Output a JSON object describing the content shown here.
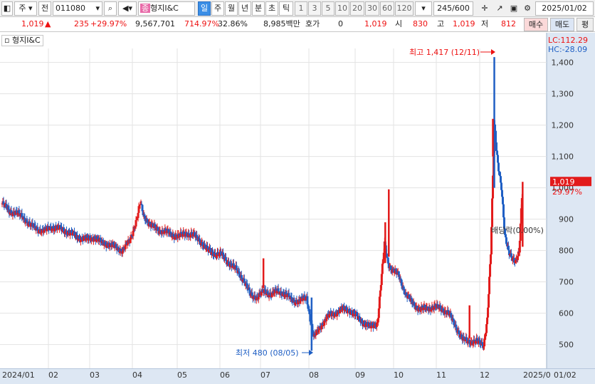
{
  "toolbar": {
    "market": "주",
    "prev": "전",
    "code": "011080",
    "stock_name": "형지I&C",
    "name_badge": "종",
    "periods": [
      "일",
      "주",
      "월",
      "년",
      "분",
      "초",
      "틱"
    ],
    "active_period": "일",
    "intervals": [
      "1",
      "3",
      "5",
      "10",
      "20",
      "30",
      "60",
      "120"
    ],
    "count": "245/600",
    "date": "2025/01/02"
  },
  "info": {
    "price": "1,019",
    "change": "235",
    "change_pct": "+29.97%",
    "volume": "9,567,701",
    "vol_ratio": "714.97%",
    "turnover": "32.86%",
    "amount": "8,985백만",
    "hoga_label": "호가",
    "hoga_value": "0",
    "hoga_price": "1,019",
    "open_label": "시",
    "open": "830",
    "high_label": "고",
    "high": "1,019",
    "low_label": "저",
    "low": "812",
    "buy_btn": "매수",
    "sell_btn": "매도",
    "eval_btn": "평"
  },
  "legend": {
    "name": "형지I&C"
  },
  "chart_data": {
    "type": "candlestick",
    "title": "형지I&C",
    "ylim": [
      440,
      1440
    ],
    "yticks": [
      "1,400",
      "1,300",
      "1,200",
      "1,100",
      "1,000",
      "900",
      "800",
      "700",
      "600",
      "500"
    ],
    "xticks": [
      "2024/01",
      "02",
      "03",
      "04",
      "05",
      "06",
      "07",
      "08",
      "09",
      "10",
      "11",
      "12",
      "2025/0",
      "01/02"
    ],
    "lc": "LC:112.29",
    "hc": "HC:-28.09",
    "last_price_label": "1,019",
    "last_change_label": "29.97%",
    "max_annotation": "최고 1,417 (12/11)",
    "min_annotation": "최저 480 (08/05)",
    "div_annotation": "배당락(0.00%)",
    "series": [
      {
        "name": "close",
        "points": [
          [
            0,
            950
          ],
          [
            10,
            925
          ],
          [
            20,
            920
          ],
          [
            30,
            905
          ],
          [
            40,
            880
          ],
          [
            50,
            868
          ],
          [
            60,
            862
          ],
          [
            70,
            875
          ],
          [
            80,
            870
          ],
          [
            90,
            862
          ],
          [
            100,
            850
          ],
          [
            110,
            840
          ],
          [
            120,
            835
          ],
          [
            130,
            842
          ],
          [
            140,
            825
          ],
          [
            150,
            820
          ],
          [
            160,
            810
          ],
          [
            170,
            800
          ],
          [
            180,
            830
          ],
          [
            190,
            900
          ],
          [
            195,
            950
          ],
          [
            200,
            910
          ],
          [
            210,
            880
          ],
          [
            220,
            865
          ],
          [
            230,
            860
          ],
          [
            240,
            850
          ],
          [
            250,
            845
          ],
          [
            260,
            855
          ],
          [
            270,
            848
          ],
          [
            280,
            830
          ],
          [
            290,
            800
          ],
          [
            300,
            790
          ],
          [
            310,
            785
          ],
          [
            320,
            760
          ],
          [
            330,
            740
          ],
          [
            340,
            710
          ],
          [
            350,
            660
          ],
          [
            360,
            650
          ],
          [
            370,
            670
          ],
          [
            380,
            660
          ],
          [
            390,
            670
          ],
          [
            400,
            660
          ],
          [
            410,
            640
          ],
          [
            420,
            638
          ],
          [
            430,
            650
          ],
          [
            440,
            520
          ],
          [
            450,
            560
          ],
          [
            460,
            590
          ],
          [
            470,
            600
          ],
          [
            480,
            612
          ],
          [
            490,
            610
          ],
          [
            500,
            590
          ],
          [
            510,
            570
          ],
          [
            520,
            555
          ],
          [
            530,
            570
          ],
          [
            540,
            820
          ],
          [
            545,
            760
          ],
          [
            550,
            740
          ],
          [
            560,
            720
          ],
          [
            570,
            660
          ],
          [
            580,
            630
          ],
          [
            590,
            612
          ],
          [
            600,
            615
          ],
          [
            610,
            620
          ],
          [
            620,
            615
          ],
          [
            630,
            600
          ],
          [
            640,
            560
          ],
          [
            650,
            515
          ],
          [
            660,
            510
          ],
          [
            670,
            508
          ],
          [
            680,
            500
          ],
          [
            685,
            580
          ],
          [
            690,
            790
          ],
          [
            695,
            1200
          ],
          [
            700,
            1080
          ],
          [
            705,
            1000
          ],
          [
            710,
            840
          ],
          [
            715,
            800
          ],
          [
            720,
            780
          ],
          [
            725,
            760
          ],
          [
            730,
            790
          ],
          [
            735,
            1019
          ]
        ]
      }
    ]
  }
}
